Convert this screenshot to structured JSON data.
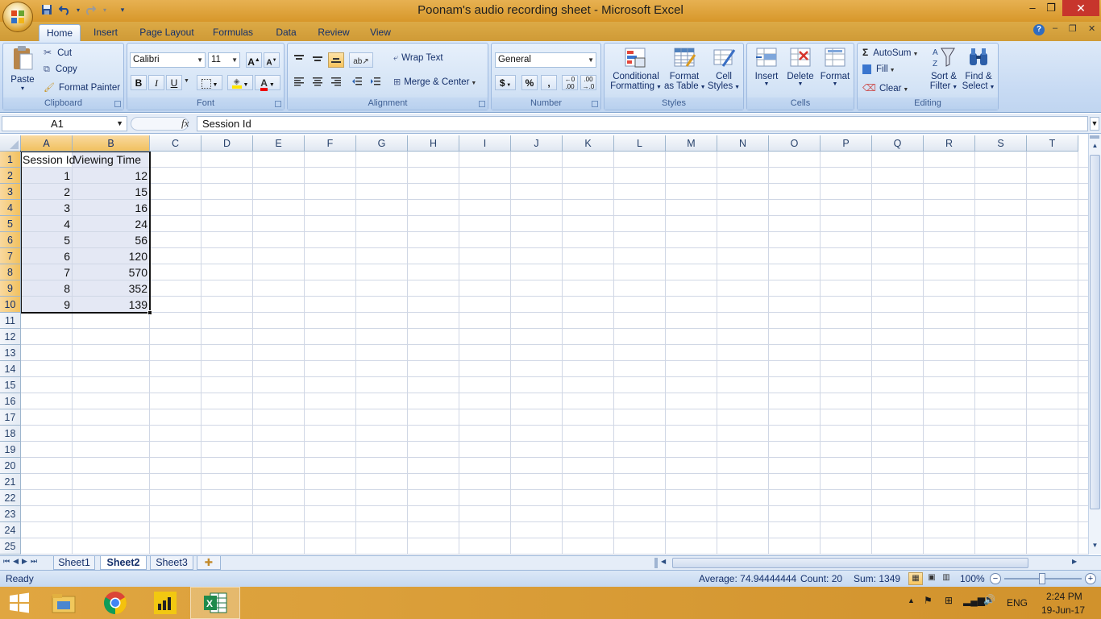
{
  "window": {
    "title": "Poonam's audio recording sheet - Microsoft Excel"
  },
  "tabs": [
    "Home",
    "Insert",
    "Page Layout",
    "Formulas",
    "Data",
    "Review",
    "View"
  ],
  "clipboard": {
    "paste": "Paste",
    "cut": "Cut",
    "copy": "Copy",
    "format_painter": "Format Painter",
    "label": "Clipboard"
  },
  "font": {
    "name": "Calibri",
    "size": "11",
    "label": "Font",
    "bold": "B",
    "italic": "I",
    "underline": "U",
    "grow": "A",
    "shrink": "A",
    "color_letter": "A"
  },
  "alignment": {
    "wrap_text": "Wrap Text",
    "merge_center": "Merge & Center",
    "label": "Alignment"
  },
  "number": {
    "format": "General",
    "currency": "$",
    "percent": "%",
    "comma": ",",
    "label": "Number"
  },
  "styles": {
    "conditional_1": "Conditional",
    "conditional_2": "Formatting",
    "format_table_1": "Format",
    "format_table_2": "as Table",
    "cell_styles_1": "Cell",
    "cell_styles_2": "Styles",
    "label": "Styles"
  },
  "cells": {
    "insert": "Insert",
    "delete": "Delete",
    "format": "Format",
    "label": "Cells"
  },
  "editing": {
    "autosum": "AutoSum",
    "fill": "Fill",
    "clear": "Clear",
    "sort_1": "Sort &",
    "sort_2": "Filter",
    "find_1": "Find &",
    "find_2": "Select",
    "label": "Editing"
  },
  "formula_bar": {
    "name_box": "A1",
    "fx": "fx",
    "content": "Session Id"
  },
  "columns": [
    "A",
    "B",
    "C",
    "D",
    "E",
    "F",
    "G",
    "H",
    "I",
    "J",
    "K",
    "L",
    "M",
    "N",
    "O",
    "P",
    "Q",
    "R",
    "S",
    "T"
  ],
  "rows": [
    "1",
    "2",
    "3",
    "4",
    "5",
    "6",
    "7",
    "8",
    "9",
    "10",
    "11",
    "12",
    "13",
    "14",
    "15",
    "16",
    "17",
    "18",
    "19",
    "20",
    "21",
    "22",
    "23",
    "24",
    "25"
  ],
  "sheet": {
    "headers": [
      "Session Id",
      "Viewing Time"
    ],
    "data": [
      [
        "1",
        "12"
      ],
      [
        "2",
        "15"
      ],
      [
        "3",
        "16"
      ],
      [
        "4",
        "24"
      ],
      [
        "5",
        "56"
      ],
      [
        "6",
        "120"
      ],
      [
        "7",
        "570"
      ],
      [
        "8",
        "352"
      ],
      [
        "9",
        "139"
      ]
    ]
  },
  "sheet_tabs": [
    "Sheet1",
    "Sheet2",
    "Sheet3"
  ],
  "active_sheet": "Sheet2",
  "status": {
    "ready": "Ready",
    "average": "Average: 74.94444444",
    "count": "Count: 20",
    "sum": "Sum: 1349",
    "zoom": "100%"
  },
  "taskbar": {
    "language": "ENG",
    "time": "2:24 PM",
    "date": "19-Jun-17"
  },
  "colors": {
    "accent": "#dda84a",
    "ribbon": "#c7daf3",
    "selection": "#f1c15f",
    "close": "#c7352c"
  }
}
